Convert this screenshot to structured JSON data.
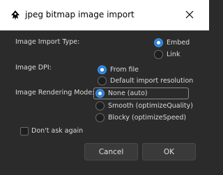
{
  "window": {
    "title": "jpeg bitmap image import",
    "app_icon": "inkscape-icon",
    "close_icon": "close-icon"
  },
  "import_type": {
    "label": "Image Import Type:",
    "options": [
      {
        "label": "Embed",
        "checked": true
      },
      {
        "label": "Link",
        "checked": false
      }
    ]
  },
  "dpi": {
    "label": "Image DPI:",
    "options": [
      {
        "label": "From file",
        "checked": true
      },
      {
        "label": "Default import resolution",
        "checked": false
      }
    ]
  },
  "rendering": {
    "label": "Image Rendering Mode:",
    "options": [
      {
        "label": "None (auto)",
        "checked": true
      },
      {
        "label": "Smooth (optimizeQuality)",
        "checked": false
      },
      {
        "label": "Blocky (optimizeSpeed)",
        "checked": false
      }
    ]
  },
  "dont_ask": {
    "label": "Don't ask again",
    "checked": false
  },
  "buttons": {
    "cancel": "Cancel",
    "ok": "OK"
  },
  "colors": {
    "accent": "#2f82d6",
    "background": "#2b2b2b",
    "titlebar": "#ffffff"
  }
}
